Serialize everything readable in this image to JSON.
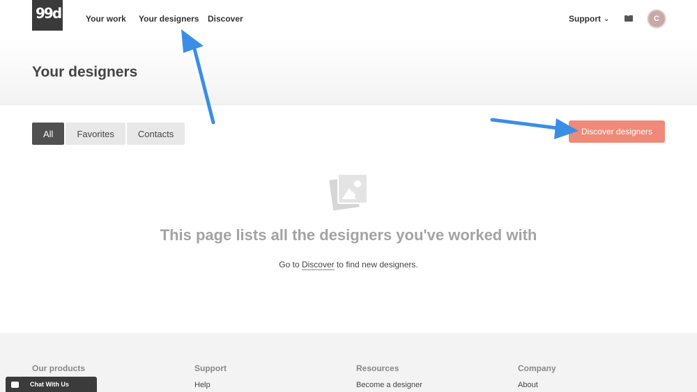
{
  "nav": {
    "logo": "99d",
    "your_work": "Your work",
    "your_designers": "Your designers",
    "discover": "Discover",
    "support": "Support",
    "avatar_initial": "C"
  },
  "page": {
    "title": "Your designers"
  },
  "tabs": [
    {
      "label": "All",
      "active": true
    },
    {
      "label": "Favorites",
      "active": false
    },
    {
      "label": "Contacts",
      "active": false
    }
  ],
  "cta": {
    "label": "Discover designers",
    "color": "#ef8a78"
  },
  "empty_state": {
    "icon": "image-gallery-icon",
    "heading": "This page lists all the designers you've worked with",
    "sub_prefix": "Go to ",
    "sub_link": "Discover",
    "sub_suffix": " to find new designers."
  },
  "footer": {
    "columns": [
      {
        "heading": "Our products",
        "items": []
      },
      {
        "heading": "Support",
        "items": [
          "Help"
        ]
      },
      {
        "heading": "Resources",
        "items": [
          "Become a designer"
        ]
      },
      {
        "heading": "Company",
        "items": [
          "About"
        ]
      }
    ]
  },
  "chat": {
    "label": "Chat With Us",
    "icon": "chat-bubble-icon"
  },
  "annotation_color": "#3a8ee6"
}
